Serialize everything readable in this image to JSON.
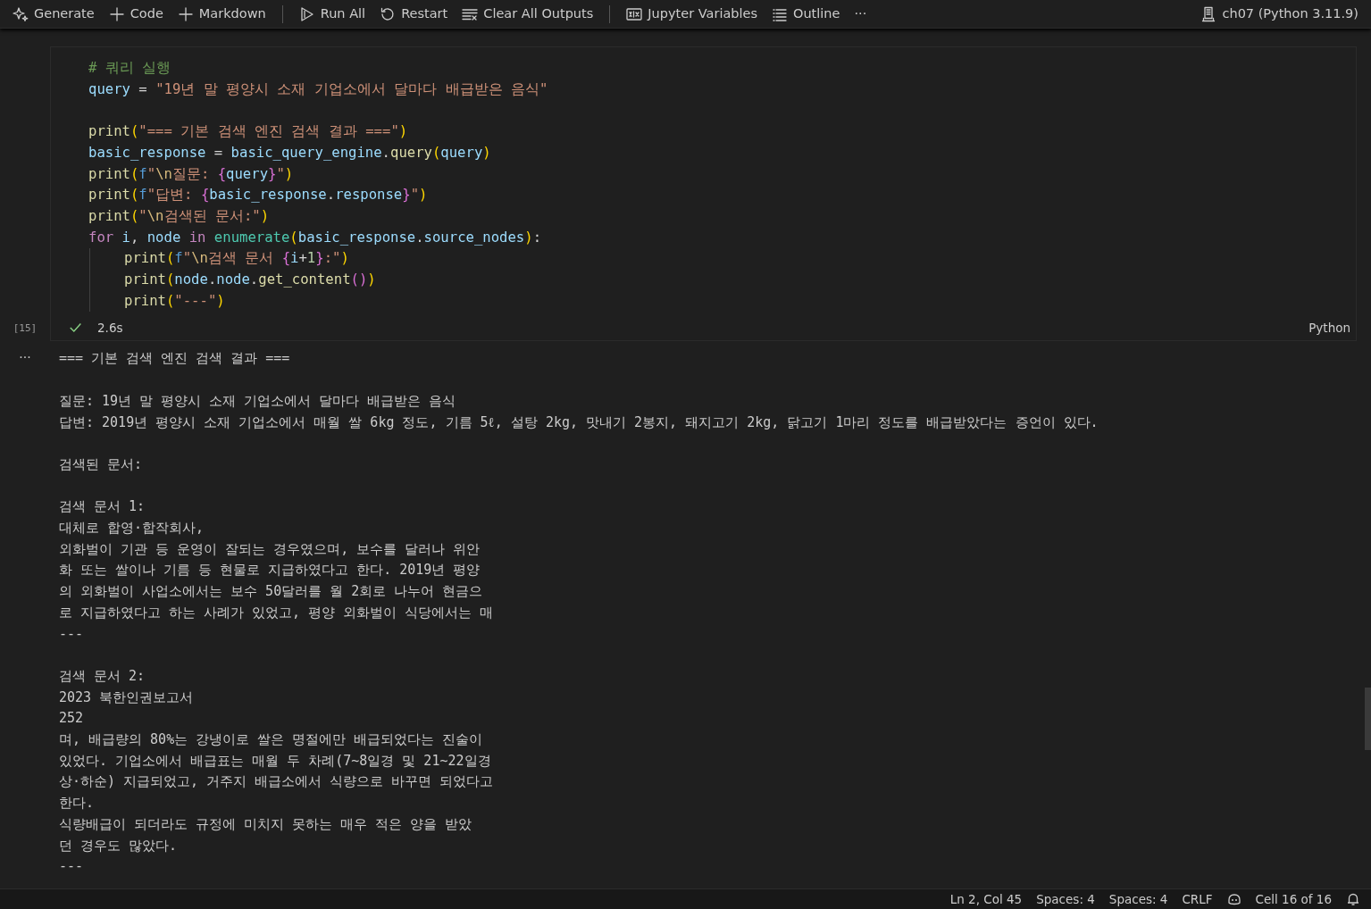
{
  "toolbar": {
    "groups": [
      [
        {
          "kind": "sparkle",
          "label": "Generate"
        },
        {
          "kind": "plus",
          "label": "Code"
        },
        {
          "kind": "plus",
          "label": "Markdown"
        }
      ],
      [
        {
          "kind": "play",
          "label": "Run All"
        },
        {
          "kind": "restart",
          "label": "Restart"
        },
        {
          "kind": "clear",
          "label": "Clear All Outputs"
        }
      ],
      [
        {
          "kind": "variables",
          "label": "Jupyter Variables"
        },
        {
          "kind": "outline",
          "label": "Outline"
        }
      ]
    ],
    "more": "···",
    "kernel": "ch07 (Python 3.11.9)"
  },
  "cell": {
    "execution_count": "[15]",
    "succeeded": true,
    "duration": "2.6s",
    "language": "Python",
    "code_blocks": [
      [
        {
          "indented": false,
          "tokens": [
            {
              "kind": "com",
              "text": "# 쿼리 실행"
            }
          ]
        },
        {
          "indented": false,
          "tokens": [
            {
              "kind": "var",
              "text": "query"
            },
            {
              "kind": "plain",
              "text": " = "
            },
            {
              "kind": "str",
              "text": "\"19년 말 평양시 소재 기업소에서 달마다 배급받은 음식\""
            }
          ]
        }
      ],
      [
        {
          "indented": false,
          "tokens": [
            {
              "kind": "fn",
              "text": "print"
            },
            {
              "kind": "b1",
              "text": "("
            },
            {
              "kind": "str",
              "text": "\"=== 기본 검색 엔진 검색 결과 ===\""
            },
            {
              "kind": "b1",
              "text": ")"
            }
          ]
        },
        {
          "indented": false,
          "tokens": [
            {
              "kind": "var",
              "text": "basic_response"
            },
            {
              "kind": "plain",
              "text": " = "
            },
            {
              "kind": "var",
              "text": "basic_query_engine"
            },
            {
              "kind": "plain",
              "text": "."
            },
            {
              "kind": "fn",
              "text": "query"
            },
            {
              "kind": "b1",
              "text": "("
            },
            {
              "kind": "var",
              "text": "query"
            },
            {
              "kind": "b1",
              "text": ")"
            }
          ]
        },
        {
          "indented": false,
          "tokens": [
            {
              "kind": "fn",
              "text": "print"
            },
            {
              "kind": "b1",
              "text": "("
            },
            {
              "kind": "fpre",
              "text": "f"
            },
            {
              "kind": "str",
              "text": "\""
            },
            {
              "kind": "esc",
              "text": "\\n"
            },
            {
              "kind": "str",
              "text": "질문: "
            },
            {
              "kind": "b2",
              "text": "{"
            },
            {
              "kind": "var",
              "text": "query"
            },
            {
              "kind": "b2",
              "text": "}"
            },
            {
              "kind": "str",
              "text": "\""
            },
            {
              "kind": "b1",
              "text": ")"
            }
          ]
        },
        {
          "indented": false,
          "tokens": [
            {
              "kind": "fn",
              "text": "print"
            },
            {
              "kind": "b1",
              "text": "("
            },
            {
              "kind": "fpre",
              "text": "f"
            },
            {
              "kind": "str",
              "text": "\"답변: "
            },
            {
              "kind": "b2",
              "text": "{"
            },
            {
              "kind": "var",
              "text": "basic_response"
            },
            {
              "kind": "plain",
              "text": "."
            },
            {
              "kind": "var",
              "text": "response"
            },
            {
              "kind": "b2",
              "text": "}"
            },
            {
              "kind": "str",
              "text": "\""
            },
            {
              "kind": "b1",
              "text": ")"
            }
          ]
        },
        {
          "indented": false,
          "tokens": [
            {
              "kind": "fn",
              "text": "print"
            },
            {
              "kind": "b1",
              "text": "("
            },
            {
              "kind": "str",
              "text": "\""
            },
            {
              "kind": "esc",
              "text": "\\n"
            },
            {
              "kind": "str",
              "text": "검색된 문서:\""
            },
            {
              "kind": "b1",
              "text": ")"
            }
          ]
        },
        {
          "indented": false,
          "tokens": [
            {
              "kind": "kw",
              "text": "for "
            },
            {
              "kind": "var",
              "text": "i"
            },
            {
              "kind": "plain",
              "text": ", "
            },
            {
              "kind": "var",
              "text": "node"
            },
            {
              "kind": "kw",
              "text": " in "
            },
            {
              "kind": "cls",
              "text": "enumerate"
            },
            {
              "kind": "b1",
              "text": "("
            },
            {
              "kind": "var",
              "text": "basic_response"
            },
            {
              "kind": "plain",
              "text": "."
            },
            {
              "kind": "var",
              "text": "source_nodes"
            },
            {
              "kind": "b1",
              "text": ")"
            },
            {
              "kind": "plain",
              "text": ":"
            }
          ]
        },
        {
          "indented": true,
          "tokens": [
            {
              "kind": "fn",
              "text": "print"
            },
            {
              "kind": "b1",
              "text": "("
            },
            {
              "kind": "fpre",
              "text": "f"
            },
            {
              "kind": "str",
              "text": "\""
            },
            {
              "kind": "esc",
              "text": "\\n"
            },
            {
              "kind": "str",
              "text": "검색 문서 "
            },
            {
              "kind": "b2",
              "text": "{"
            },
            {
              "kind": "var",
              "text": "i"
            },
            {
              "kind": "plain",
              "text": "+"
            },
            {
              "kind": "num",
              "text": "1"
            },
            {
              "kind": "b2",
              "text": "}"
            },
            {
              "kind": "str",
              "text": ":\""
            },
            {
              "kind": "b1",
              "text": ")"
            }
          ]
        },
        {
          "indented": true,
          "tokens": [
            {
              "kind": "fn",
              "text": "print"
            },
            {
              "kind": "b1",
              "text": "("
            },
            {
              "kind": "var",
              "text": "node"
            },
            {
              "kind": "plain",
              "text": "."
            },
            {
              "kind": "var",
              "text": "node"
            },
            {
              "kind": "plain",
              "text": "."
            },
            {
              "kind": "fn",
              "text": "get_content"
            },
            {
              "kind": "b2",
              "text": "()"
            },
            {
              "kind": "b1",
              "text": ")"
            }
          ]
        },
        {
          "indented": true,
          "tokens": [
            {
              "kind": "fn",
              "text": "print"
            },
            {
              "kind": "b1",
              "text": "("
            },
            {
              "kind": "str",
              "text": "\"---\""
            },
            {
              "kind": "b1",
              "text": ")"
            }
          ]
        }
      ]
    ]
  },
  "output": {
    "more": "···",
    "blocks": [
      [
        "=== 기본 검색 엔진 검색 결과 ==="
      ],
      [
        "질문: 19년 말 평양시 소재 기업소에서 달마다 배급받은 음식",
        "답변: 2019년 평양시 소재 기업소에서 매월 쌀 6kg 정도, 기름 5ℓ, 설탕 2kg, 맛내기 2봉지, 돼지고기 2kg, 닭고기 1마리 정도를 배급받았다는 증언이 있다."
      ],
      [
        "검색된 문서:"
      ],
      [
        "검색 문서 1:",
        "대체로 합영·합작회사,",
        "외화벌이 기관 등 운영이 잘되는 경우였으며, 보수를 달러나 위안",
        "화 또는 쌀이나 기름 등 현물로 지급하였다고 한다. 2019년 평양",
        "의 외화벌이 사업소에서는 보수 50달러를 월 2회로 나누어 현금으",
        "로 지급하였다고 하는 사례가 있었고, 평양 외화벌이 식당에서는 매",
        "---"
      ],
      [
        "검색 문서 2:",
        "2023 북한인권보고서",
        "252",
        "며, 배급량의 80%는 강냉이로 쌀은 명절에만 배급되었다는 진술이",
        "있었다. 기업소에서 배급표는 매월 두 차례(7~8일경 및 21~22일경",
        "상·하순) 지급되었고, 거주지 배급소에서 식량으로 바꾸면 되었다고",
        "한다.",
        "식량배급이 되더라도 규정에 미치지 못하는 매우 적은 양을 받았",
        "던 경우도 많았다.",
        "---"
      ]
    ]
  },
  "status_bar": {
    "items": [
      "Ln 2, Col 45",
      "Spaces: 4",
      "Spaces: 4",
      "CRLF"
    ],
    "cell_position": "Cell 16 of 16"
  }
}
